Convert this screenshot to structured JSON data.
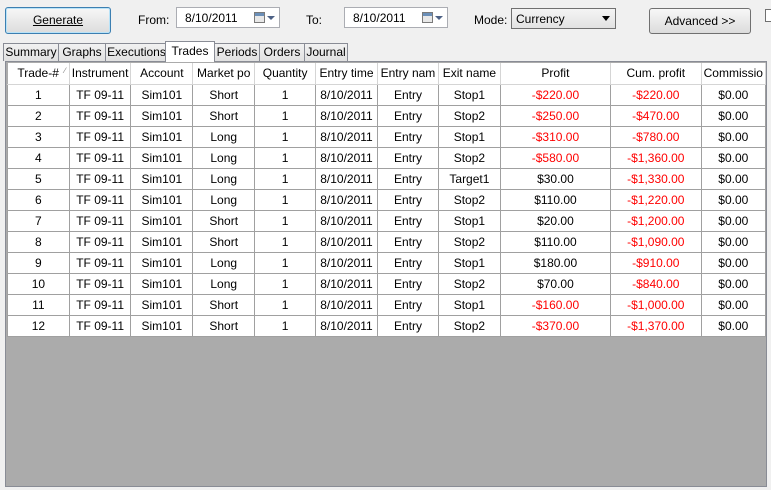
{
  "toolbar": {
    "generate_label": "Generate",
    "from_label": "From:",
    "from_value": "8/10/2011",
    "to_label": "To:",
    "to_value": "8/10/2011",
    "mode_label": "Mode:",
    "mode_value": "Currency",
    "advanced_label": "Advanced >>"
  },
  "tabs": [
    {
      "label": "Summary",
      "active": false
    },
    {
      "label": "Graphs",
      "active": false
    },
    {
      "label": "Executions",
      "active": false
    },
    {
      "label": "Trades",
      "active": true
    },
    {
      "label": "Periods",
      "active": false
    },
    {
      "label": "Orders",
      "active": false
    },
    {
      "label": "Journal",
      "active": false
    }
  ],
  "table": {
    "columns": [
      "Trade-#",
      "Instrument",
      "Account",
      "Market po",
      "Quantity",
      "Entry time",
      "Entry nam",
      "Exit name",
      "Profit",
      "Cum. profit",
      "Commissio"
    ],
    "sorted_column_indicator": "sort-up-icon",
    "negative_color": "#ff0000",
    "rows": [
      [
        "1",
        "TF 09-11",
        "Sim101",
        "Short",
        "1",
        "8/10/2011",
        "Entry",
        "Stop1",
        "-$220.00",
        "-$220.00",
        "$0.00"
      ],
      [
        "2",
        "TF 09-11",
        "Sim101",
        "Short",
        "1",
        "8/10/2011",
        "Entry",
        "Stop2",
        "-$250.00",
        "-$470.00",
        "$0.00"
      ],
      [
        "3",
        "TF 09-11",
        "Sim101",
        "Long",
        "1",
        "8/10/2011",
        "Entry",
        "Stop1",
        "-$310.00",
        "-$780.00",
        "$0.00"
      ],
      [
        "4",
        "TF 09-11",
        "Sim101",
        "Long",
        "1",
        "8/10/2011",
        "Entry",
        "Stop2",
        "-$580.00",
        "-$1,360.00",
        "$0.00"
      ],
      [
        "5",
        "TF 09-11",
        "Sim101",
        "Long",
        "1",
        "8/10/2011",
        "Entry",
        "Target1",
        "$30.00",
        "-$1,330.00",
        "$0.00"
      ],
      [
        "6",
        "TF 09-11",
        "Sim101",
        "Long",
        "1",
        "8/10/2011",
        "Entry",
        "Stop2",
        "$110.00",
        "-$1,220.00",
        "$0.00"
      ],
      [
        "7",
        "TF 09-11",
        "Sim101",
        "Short",
        "1",
        "8/10/2011",
        "Entry",
        "Stop1",
        "$20.00",
        "-$1,200.00",
        "$0.00"
      ],
      [
        "8",
        "TF 09-11",
        "Sim101",
        "Short",
        "1",
        "8/10/2011",
        "Entry",
        "Stop2",
        "$110.00",
        "-$1,090.00",
        "$0.00"
      ],
      [
        "9",
        "TF 09-11",
        "Sim101",
        "Long",
        "1",
        "8/10/2011",
        "Entry",
        "Stop1",
        "$180.00",
        "-$910.00",
        "$0.00"
      ],
      [
        "10",
        "TF 09-11",
        "Sim101",
        "Long",
        "1",
        "8/10/2011",
        "Entry",
        "Stop2",
        "$70.00",
        "-$840.00",
        "$0.00"
      ],
      [
        "11",
        "TF 09-11",
        "Sim101",
        "Short",
        "1",
        "8/10/2011",
        "Entry",
        "Stop1",
        "-$160.00",
        "-$1,000.00",
        "$0.00"
      ],
      [
        "12",
        "TF 09-11",
        "Sim101",
        "Short",
        "1",
        "8/10/2011",
        "Entry",
        "Stop2",
        "-$370.00",
        "-$1,370.00",
        "$0.00"
      ]
    ]
  }
}
